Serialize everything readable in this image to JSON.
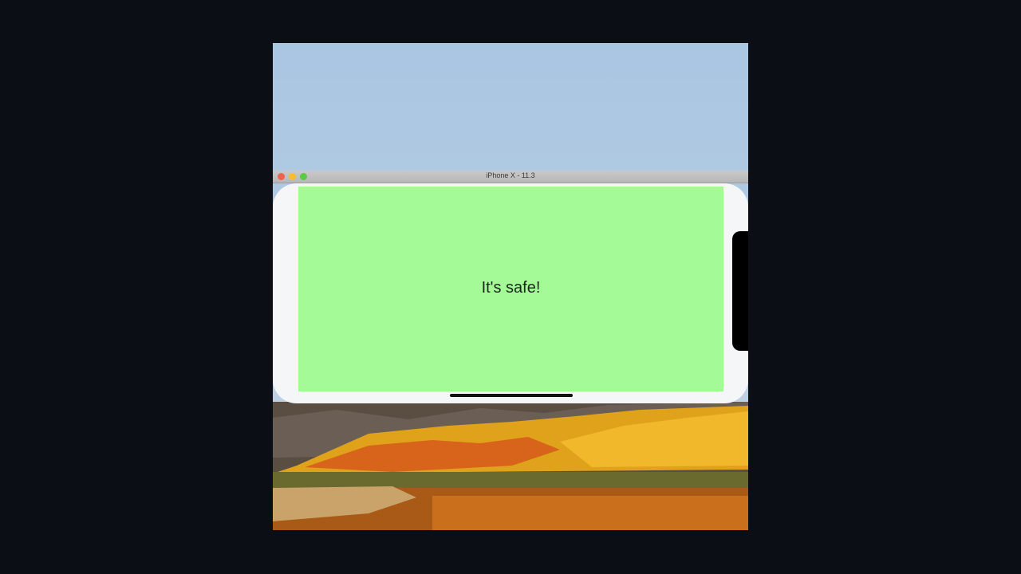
{
  "window": {
    "title": "iPhone X - 11.3"
  },
  "app": {
    "message": "It's safe!"
  },
  "colors": {
    "background": "#0b0e14",
    "screen": "#a3fa96",
    "device_frame": "#f4f6f8",
    "traffic_close": "#f0614f",
    "traffic_minimize": "#f5bd2f",
    "traffic_maximize": "#5bc94a"
  },
  "icons": {
    "close": "close-dot-icon",
    "minimize": "minimize-dot-icon",
    "maximize": "maximize-dot-icon"
  }
}
